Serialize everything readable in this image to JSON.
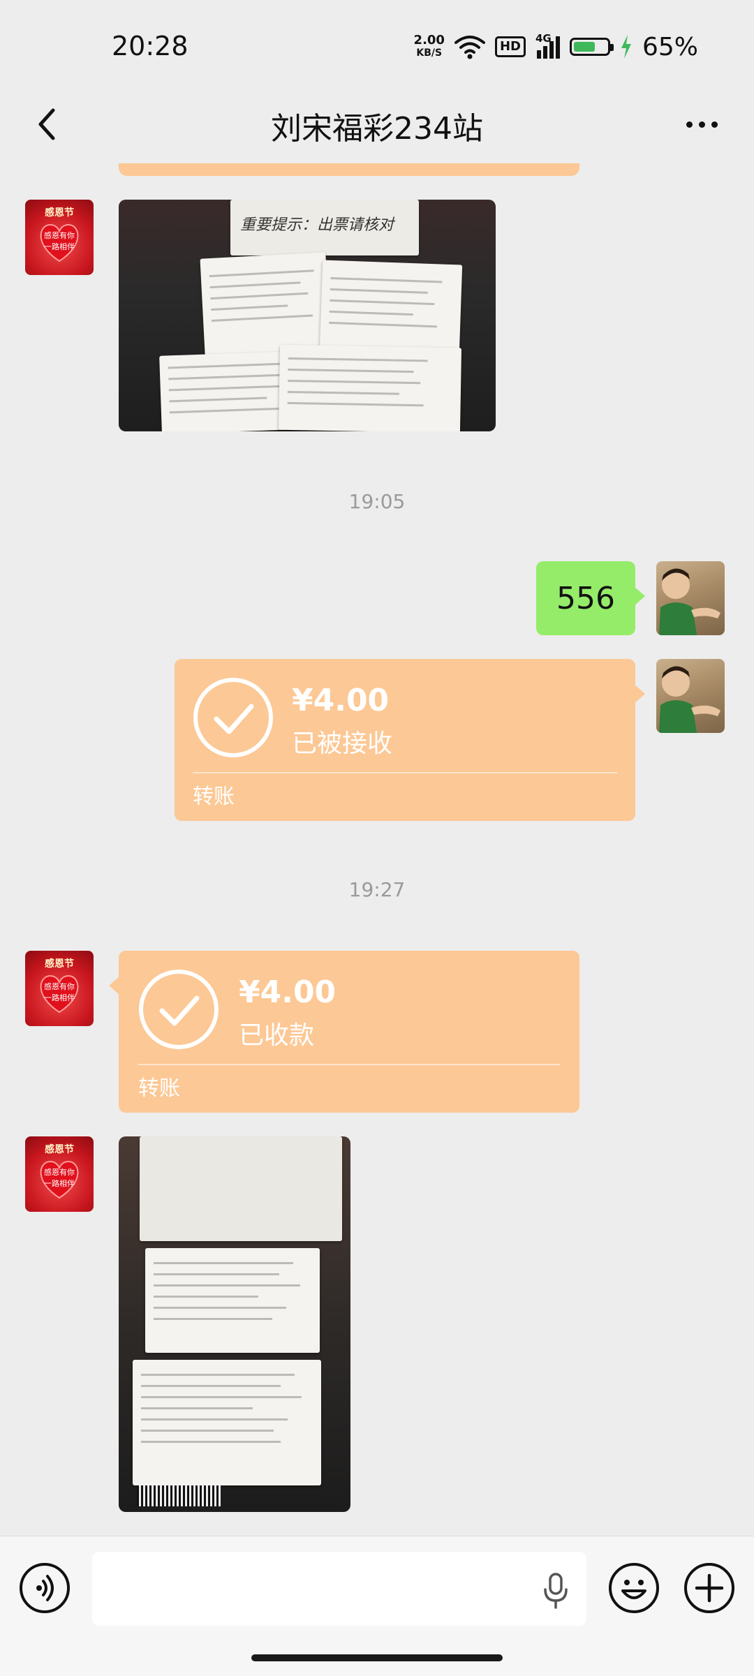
{
  "status_bar": {
    "time": "20:28",
    "net_speed_value": "2.00",
    "net_speed_unit": "KB/S",
    "hd_label": "HD",
    "network_label": "4G",
    "battery_percent": "65%",
    "battery_level": 0.65
  },
  "header": {
    "title": "刘宋福彩234站",
    "back_icon": "chevron-left-icon",
    "more_icon": "more-horizontal-icon"
  },
  "avatars": {
    "red_top_text": "感恩节",
    "red_bottom_text_1": "感恩有你",
    "red_bottom_text_2": "一路相伴"
  },
  "messages": {
    "photo_1_caption": "重要提示：出票请核对",
    "time_1": "19:05",
    "text_1": "556",
    "transfer_1": {
      "amount": "¥4.00",
      "status": "已被接收",
      "label": "转账"
    },
    "time_2": "19:27",
    "transfer_2": {
      "amount": "¥4.00",
      "status": "已收款",
      "label": "转账"
    }
  },
  "input_bar": {
    "voice_icon": "voice-mode-icon",
    "mic_icon": "microphone-icon",
    "emoji_icon": "emoji-icon",
    "plus_icon": "plus-icon"
  },
  "colors": {
    "background": "#ededed",
    "green_bubble": "#95ec69",
    "transfer_bubble": "#fcc895"
  }
}
